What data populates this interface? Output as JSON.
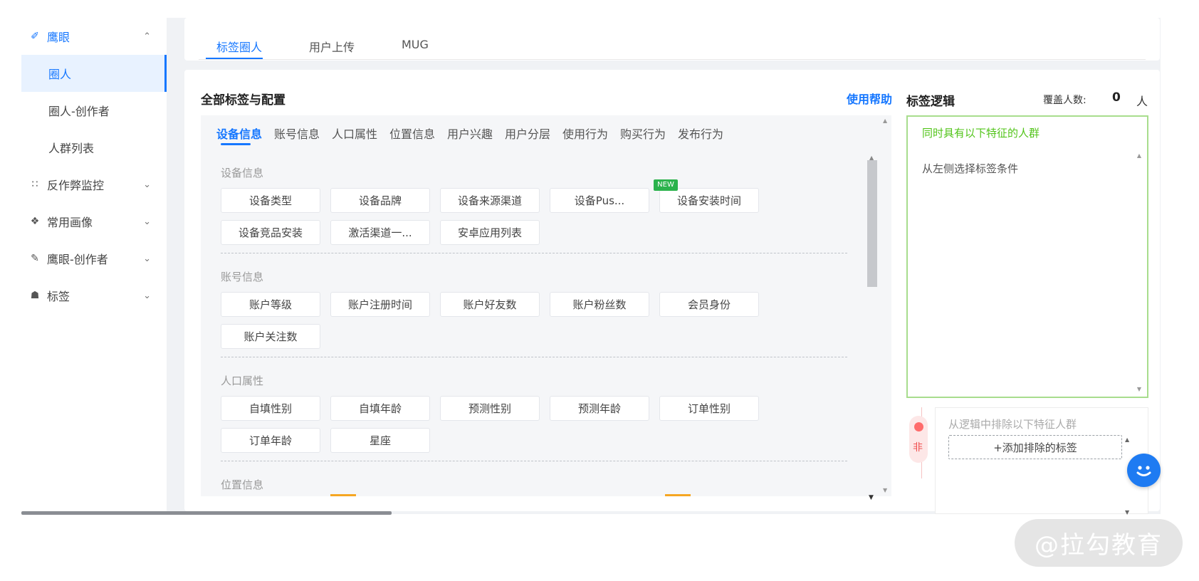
{
  "sidebar": {
    "items": [
      {
        "label": "鹰眼",
        "icon": "compass-icon",
        "chevron": "^"
      },
      {
        "label": "圈人"
      },
      {
        "label": "圈人-创作者"
      },
      {
        "label": "人群列表"
      },
      {
        "label": "反作弊监控",
        "icon": "scatter-chart-icon",
        "chevron": "v"
      },
      {
        "label": "常用画像",
        "icon": "grid-icon",
        "chevron": "v"
      },
      {
        "label": "鹰眼-创作者",
        "icon": "pen-icon",
        "chevron": "v"
      },
      {
        "label": "标签",
        "icon": "cart-icon",
        "chevron": "v"
      }
    ]
  },
  "top_tabs": [
    "标签圈人",
    "用户上传",
    "MUG"
  ],
  "section": {
    "title": "全部标签与配置",
    "help": "使用帮助"
  },
  "categories": [
    "设备信息",
    "账号信息",
    "人口属性",
    "位置信息",
    "用户兴趣",
    "用户分层",
    "使用行为",
    "购买行为",
    "发布行为"
  ],
  "groups": [
    {
      "label": "设备信息",
      "tags": [
        "设备类型",
        "设备品牌",
        "设备来源渠道",
        "设备Pus...",
        "设备安装时间",
        "设备竞品安装",
        "激活渠道一...",
        "安卓应用列表"
      ]
    },
    {
      "label": "账号信息",
      "tags": [
        "账户等级",
        "账户注册时间",
        "账户好友数",
        "账户粉丝数",
        "会员身份",
        "账户关注数"
      ]
    },
    {
      "label": "人口属性",
      "tags": [
        "自填性别",
        "自填年龄",
        "预测性别",
        "预测年龄",
        "订单性别",
        "订单年龄",
        "星座"
      ]
    },
    {
      "label": "位置信息",
      "tags": []
    }
  ],
  "new_badge": "NEW",
  "logic": {
    "title": "标签逻辑",
    "cover_label": "覆盖人数:",
    "cover_count": "0",
    "cover_unit": "人",
    "include_head": "同时具有以下特征的人群",
    "include_hint": "从左侧选择标签条件",
    "exclude_non": "非",
    "exclude_head": "从逻辑中排除以下特征人群",
    "add_exclude": "+添加排除的标签"
  },
  "watermark": "@拉勾教育",
  "colors": {
    "accent": "#1677ff",
    "include_green": "#52c41a",
    "exclude_red": "#f05050",
    "badge_green": "#2bb24c"
  }
}
